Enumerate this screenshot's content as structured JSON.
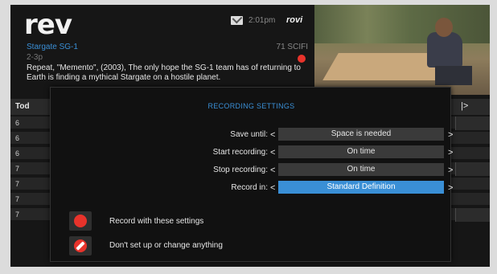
{
  "header": {
    "logo": "rev",
    "mail_icon": "envelope-icon",
    "time": "2:01pm",
    "brand": "rovi"
  },
  "program": {
    "title": "Stargate SG-1",
    "channel": "71 SCIFI",
    "time": "2-3p",
    "description": "Repeat, \"Memento\", (2003), The only hope the SG-1 team has of returning to Earth is finding a mythical Stargate on a hostile planet."
  },
  "grid": {
    "header_label": "Tod",
    "header_arrow": "|>",
    "row_labels": [
      "6",
      "6",
      "6",
      "7",
      "7",
      "7",
      "7"
    ]
  },
  "dialog": {
    "title": "RECORDING SETTINGS",
    "settings": [
      {
        "label": "Save until:",
        "value": "Space is needed",
        "active": false
      },
      {
        "label": "Start recording:",
        "value": "On time",
        "active": false
      },
      {
        "label": "Stop recording:",
        "value": "On time",
        "active": false
      },
      {
        "label": "Record in:",
        "value": "Standard Definition",
        "active": true
      }
    ],
    "arrow_left": "<",
    "arrow_right": ">",
    "options": [
      {
        "label": "Record with these settings",
        "icon": "record-icon"
      },
      {
        "label": "Don't set up or change anything",
        "icon": "cancel-icon"
      }
    ]
  },
  "colors": {
    "accent": "#3a8fd6",
    "record_red": "#e8332b",
    "background": "#161616"
  }
}
